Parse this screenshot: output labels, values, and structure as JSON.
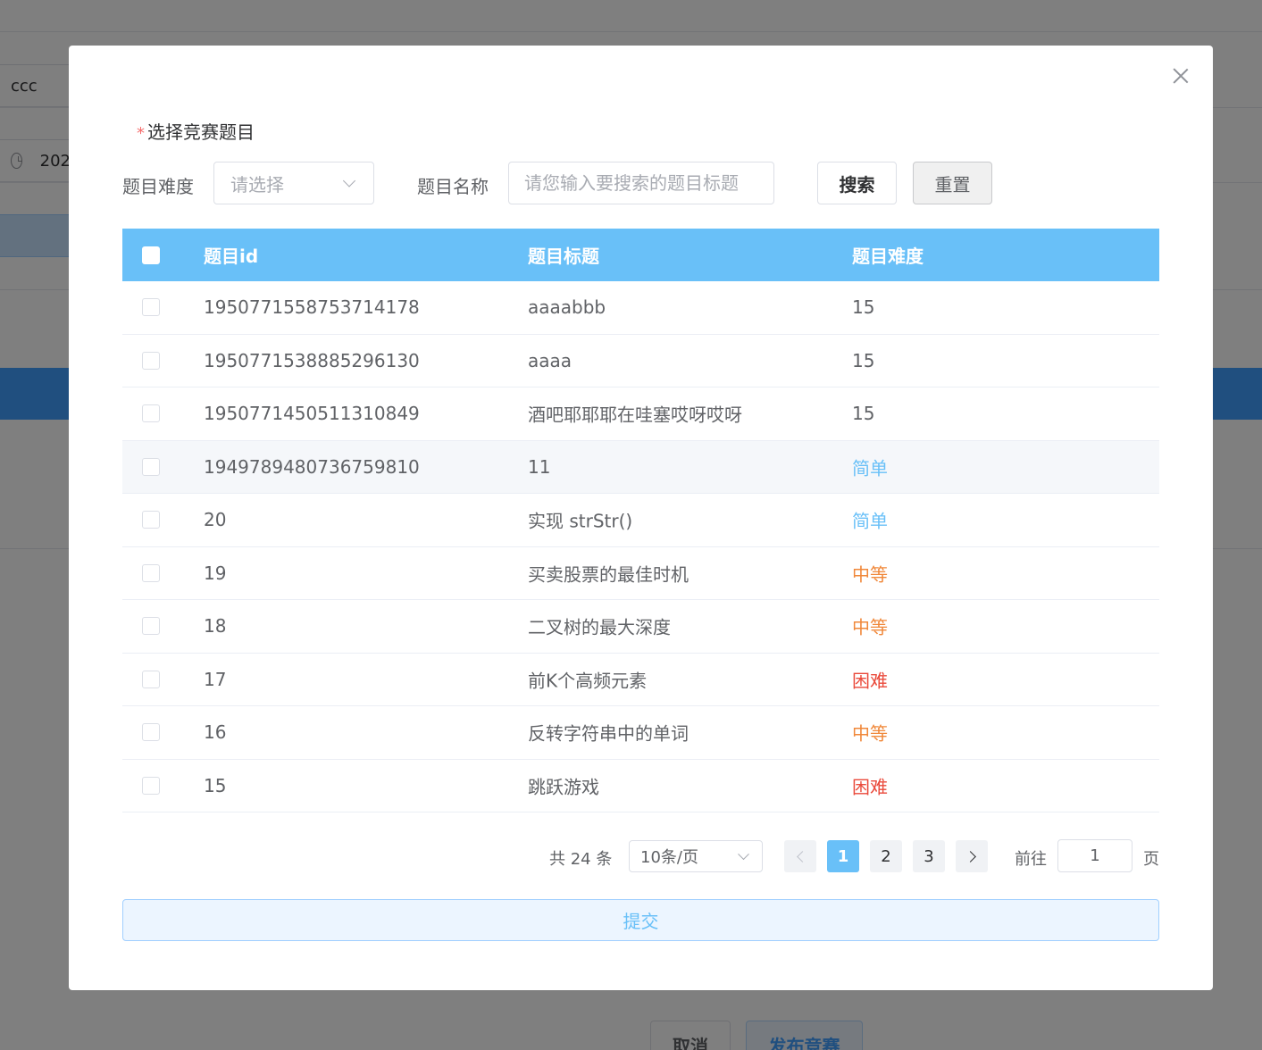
{
  "background": {
    "name_field_value": "ccc",
    "time_field_value": "202",
    "cancel_label": "取消",
    "publish_label": "发布竞赛"
  },
  "dialog": {
    "section_required_mark": "*",
    "section_title": "选择竞赛题目",
    "filters": {
      "difficulty_label": "题目难度",
      "difficulty_placeholder": "请选择",
      "name_label": "题目名称",
      "name_placeholder": "请您输入要搜索的题目标题",
      "search_label": "搜索",
      "reset_label": "重置"
    },
    "table": {
      "headers": {
        "id": "题目id",
        "title": "题目标题",
        "difficulty": "题目难度"
      },
      "rows": [
        {
          "id": "1950771558753714178",
          "title": "aaaabbb",
          "difficulty": "15"
        },
        {
          "id": "1950771538885296130",
          "title": "aaaa",
          "difficulty": "15"
        },
        {
          "id": "1950771450511310849",
          "title": "酒吧耶耶耶在哇塞哎呀哎呀",
          "difficulty": "15"
        },
        {
          "id": "1949789480736759810",
          "title": "11",
          "difficulty": "简单"
        },
        {
          "id": "20",
          "title": "实现 strStr()",
          "difficulty": "简单"
        },
        {
          "id": "19",
          "title": "买卖股票的最佳时机",
          "difficulty": "中等"
        },
        {
          "id": "18",
          "title": "二叉树的最大深度",
          "difficulty": "中等"
        },
        {
          "id": "17",
          "title": "前K个高频元素",
          "difficulty": "困难"
        },
        {
          "id": "16",
          "title": "反转字符串中的单词",
          "difficulty": "中等"
        },
        {
          "id": "15",
          "title": "跳跃游戏",
          "difficulty": "困难"
        }
      ]
    },
    "pagination": {
      "total_text": "共 24 条",
      "page_size": "10条/页",
      "pages": [
        "1",
        "2",
        "3"
      ],
      "current_page": "1",
      "goto_prefix": "前往",
      "goto_value": "1",
      "goto_suffix": "页"
    },
    "submit_label": "提交"
  },
  "colors": {
    "primary": "#69c0f8",
    "easy": "#69c0f8",
    "medium": "#f0883a",
    "hard": "#ea4a3b",
    "required": "#f56c6c"
  }
}
